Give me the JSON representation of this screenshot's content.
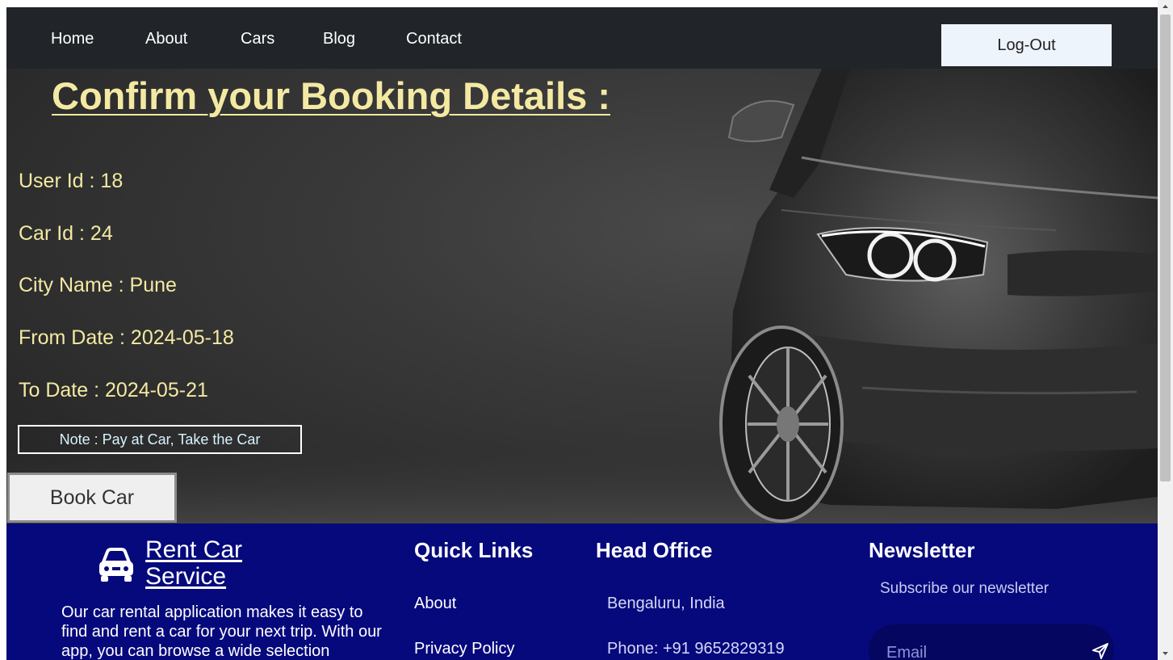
{
  "nav": {
    "items": [
      {
        "label": "Home"
      },
      {
        "label": "About"
      },
      {
        "label": "Cars"
      },
      {
        "label": "Blog"
      },
      {
        "label": "Contact"
      }
    ],
    "logout_label": "Log-Out"
  },
  "booking": {
    "title": "Confirm your Booking Details :",
    "user_id": "User Id : 18",
    "car_id": "Car Id : 24",
    "city": "City Name : Pune",
    "from_date": "From Date : 2024-05-18",
    "to_date": "To Date : 2024-05-21",
    "note": "Note : Pay at Car, Take the Car",
    "book_label": "Book Car"
  },
  "footer": {
    "brand_icon": "car-icon",
    "brand_name": "Rent Car Service",
    "brand_desc": "Our car rental application makes it easy to find and rent a car for your next trip. With our app, you can browse a wide selection",
    "quick_links": {
      "heading": "Quick Links",
      "items": [
        {
          "label": "About"
        },
        {
          "label": "Privacy Policy"
        }
      ]
    },
    "head_office": {
      "heading": "Head Office",
      "location": "Bengaluru, India",
      "phone": "Phone: +91 9652829319"
    },
    "newsletter": {
      "heading": "Newsletter",
      "subtitle": "Subscribe our newsletter",
      "email_placeholder": "Email",
      "send_icon": "send-icon"
    }
  },
  "colors": {
    "nav_bg": "#212529",
    "title_text": "#f4e9a3",
    "footer_bg": "#06097c"
  }
}
